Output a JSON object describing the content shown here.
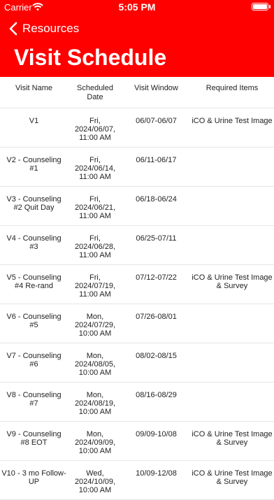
{
  "status": {
    "carrier": "Carrier",
    "time": "5:05 PM"
  },
  "nav": {
    "back_label": "Resources",
    "title": "Visit Schedule"
  },
  "table": {
    "headers": [
      "Visit Name",
      "Scheduled Date",
      "Visit Window",
      "Required Items"
    ],
    "rows": [
      {
        "name": "V1",
        "date": "Fri, 2024/06/07, 11:00 AM",
        "window": "06/07-06/07",
        "items": "iCO & Urine Test Image"
      },
      {
        "name": "V2 - Counseling #1",
        "date": "Fri, 2024/06/14, 11:00 AM",
        "window": "06/11-06/17",
        "items": ""
      },
      {
        "name": "V3 - Counseling #2 Quit Day",
        "date": "Fri, 2024/06/21, 11:00 AM",
        "window": "06/18-06/24",
        "items": ""
      },
      {
        "name": "V4 - Counseling #3",
        "date": "Fri, 2024/06/28, 11:00 AM",
        "window": "06/25-07/11",
        "items": ""
      },
      {
        "name": "V5 - Counseling #4 Re-rand",
        "date": "Fri, 2024/07/19, 11:00 AM",
        "window": "07/12-07/22",
        "items": "iCO & Urine Test Image & Survey"
      },
      {
        "name": "V6 - Counseling #5",
        "date": "Mon, 2024/07/29, 10:00 AM",
        "window": "07/26-08/01",
        "items": ""
      },
      {
        "name": "V7 - Counseling #6",
        "date": "Mon, 2024/08/05, 10:00 AM",
        "window": "08/02-08/15",
        "items": ""
      },
      {
        "name": "V8 - Counseling #7",
        "date": "Mon, 2024/08/19, 10:00 AM",
        "window": "08/16-08/29",
        "items": ""
      },
      {
        "name": "V9 - Counseling #8 EOT",
        "date": "Mon, 2024/09/09, 10:00 AM",
        "window": "09/09-10/08",
        "items": "iCO & Urine Test Image & Survey"
      },
      {
        "name": "V10 - 3 mo Follow-UP",
        "date": "Wed, 2024/10/09, 10:00 AM",
        "window": "10/09-12/08",
        "items": "iCO & Urine Test Image & Survey"
      }
    ]
  },
  "colors": {
    "header_bg": "#ff0000",
    "header_text": "#ffffff",
    "divider": "#e6e6e6"
  }
}
